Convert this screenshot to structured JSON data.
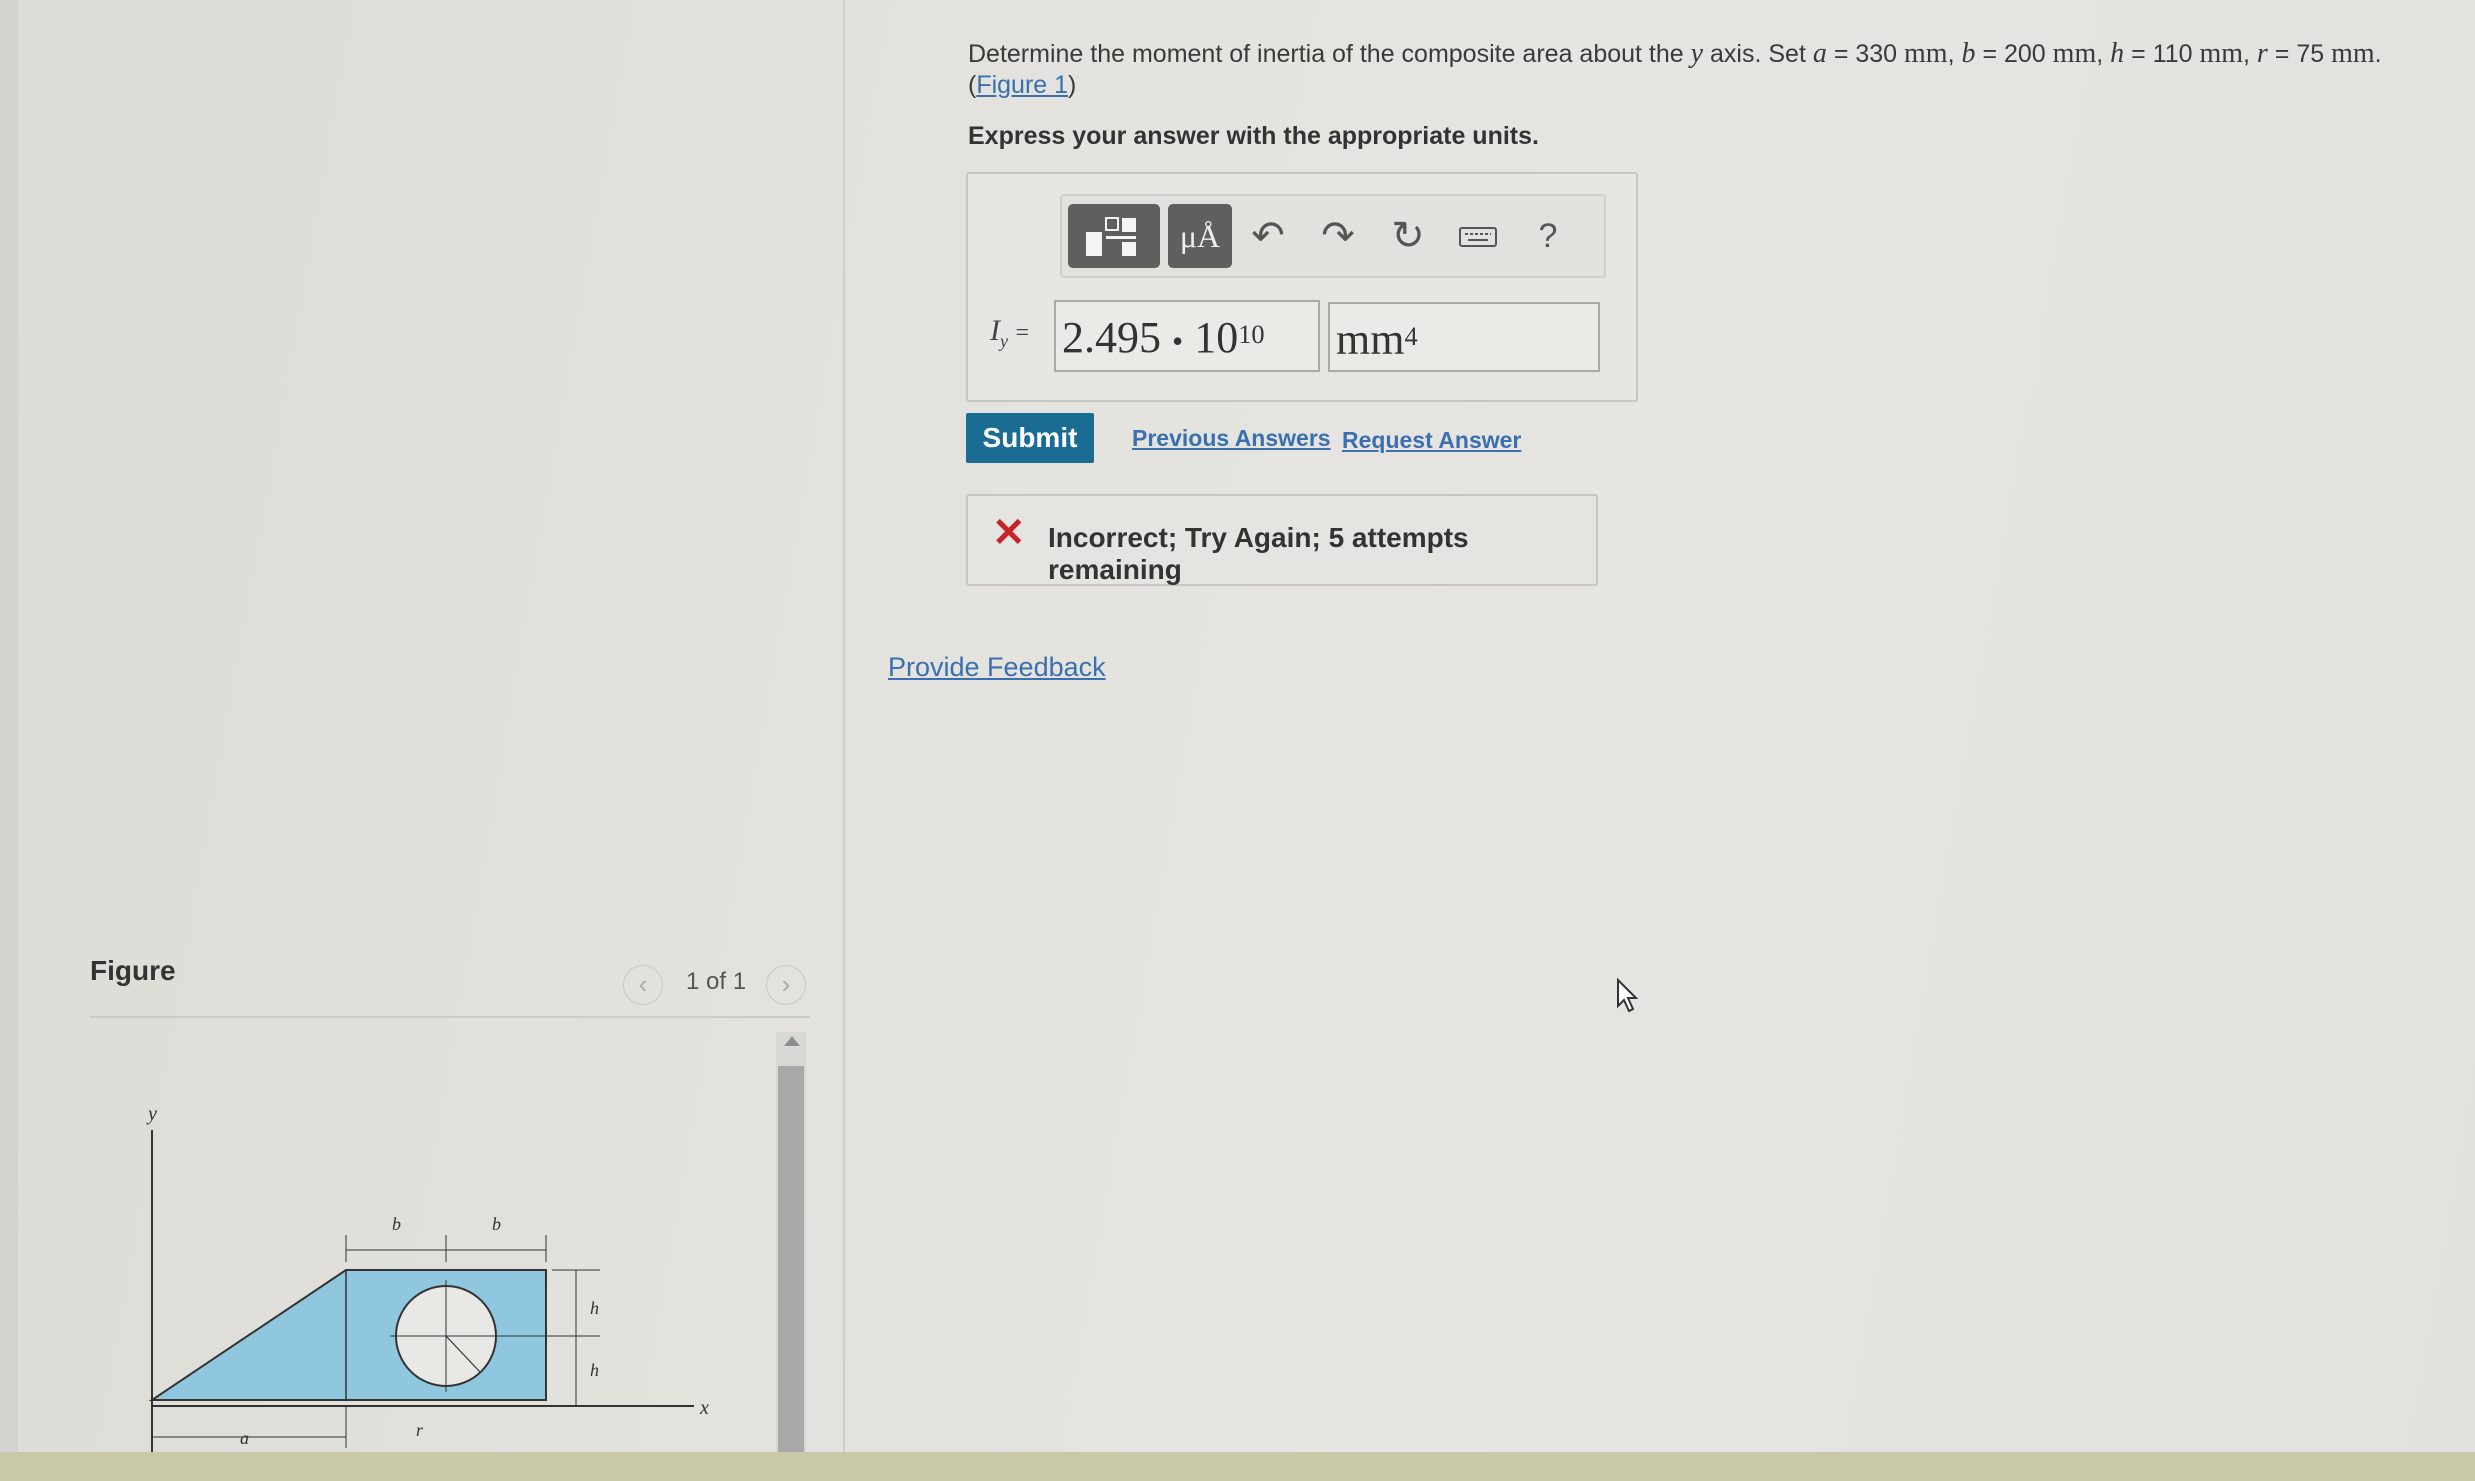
{
  "question": {
    "prefix": "Determine the moment of inertia of the composite area about the",
    "axis": "y",
    "axis_suffix": "axis. Set",
    "a_var": "a",
    "a_val": "= 330",
    "b_var": "b",
    "b_val": "= 200",
    "h_var": "h",
    "h_val": "= 110",
    "r_var": "r",
    "r_val": "= 75",
    "unit": "mm",
    "figure_link": "Figure 1"
  },
  "express_text": "Express your answer with the appropriate units.",
  "toolbar": {
    "template_icon": "template-icon",
    "units_label": "μÅ",
    "undo_icon": "undo-icon",
    "redo_icon": "redo-icon",
    "reset_icon": "reset-icon",
    "keyboard_icon": "keyboard-icon",
    "help_label": "?"
  },
  "answer": {
    "label_main": "I",
    "label_sub": "y",
    "label_eq": "=",
    "value_mantissa": "2.495",
    "value_dot": "•",
    "value_base": "10",
    "value_exp": "10",
    "unit_base": "mm",
    "unit_exp": "4"
  },
  "actions": {
    "submit": "Submit",
    "previous_answers": "Previous Answers",
    "request_answer": "Request Answer"
  },
  "feedback": {
    "message": "Incorrect; Try Again; 5 attempts remaining"
  },
  "provide_feedback": "Provide Feedback",
  "figure": {
    "title": "Figure",
    "pager": "1 of 1",
    "labels": {
      "y": "y",
      "x": "x",
      "a": "a",
      "b1": "b",
      "b2": "b",
      "h1": "h",
      "h2": "h",
      "r": "r"
    },
    "fill_color": "#8ec7de"
  },
  "colors": {
    "submit_bg": "#1b6c93",
    "link": "#3a6fb0",
    "error": "#c8222a"
  }
}
